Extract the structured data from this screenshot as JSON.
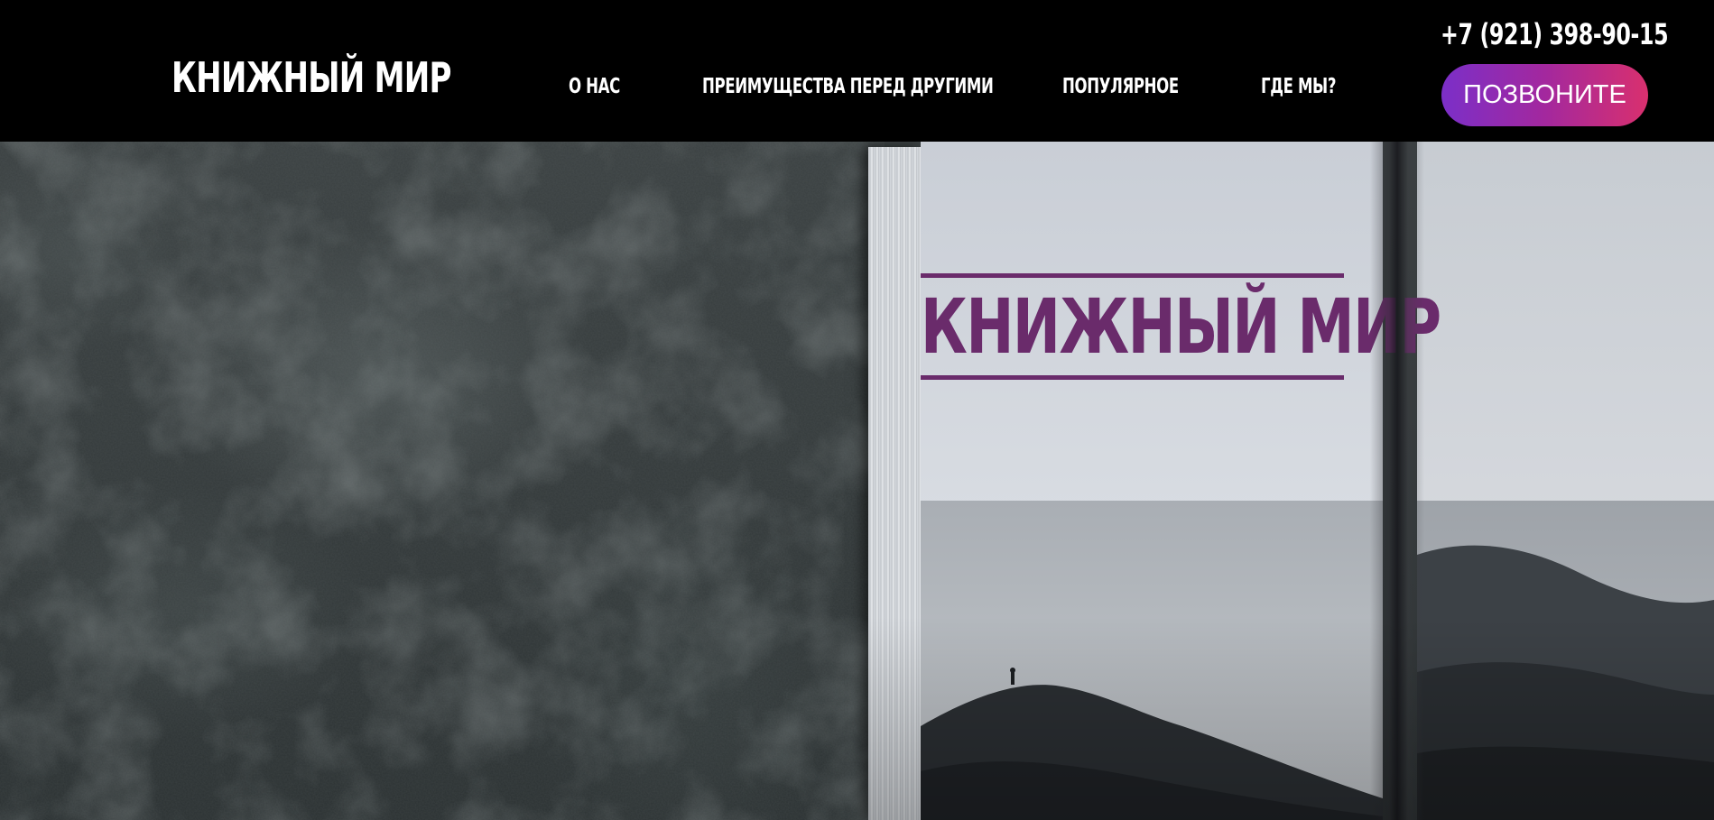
{
  "header": {
    "logo": "КНИЖНЫЙ МИР",
    "nav": {
      "about": "О НАС",
      "advantages": "ПРЕИМУЩЕСТВА ПЕРЕД ДРУГИМИ",
      "popular": "ПОПУЛЯРНОЕ",
      "where": "ГДЕ МЫ?"
    },
    "phone": "+7 (921) 398-90-15",
    "call_button": "ПОЗВОНИТЕ"
  },
  "hero": {
    "book_title": "КНИЖНЫЙ МИР"
  },
  "colors": {
    "header_bg": "#000000",
    "accent_purple": "#6a2b6b",
    "button_gradient_start": "#7b2fc8",
    "button_gradient_end": "#d9306e"
  }
}
